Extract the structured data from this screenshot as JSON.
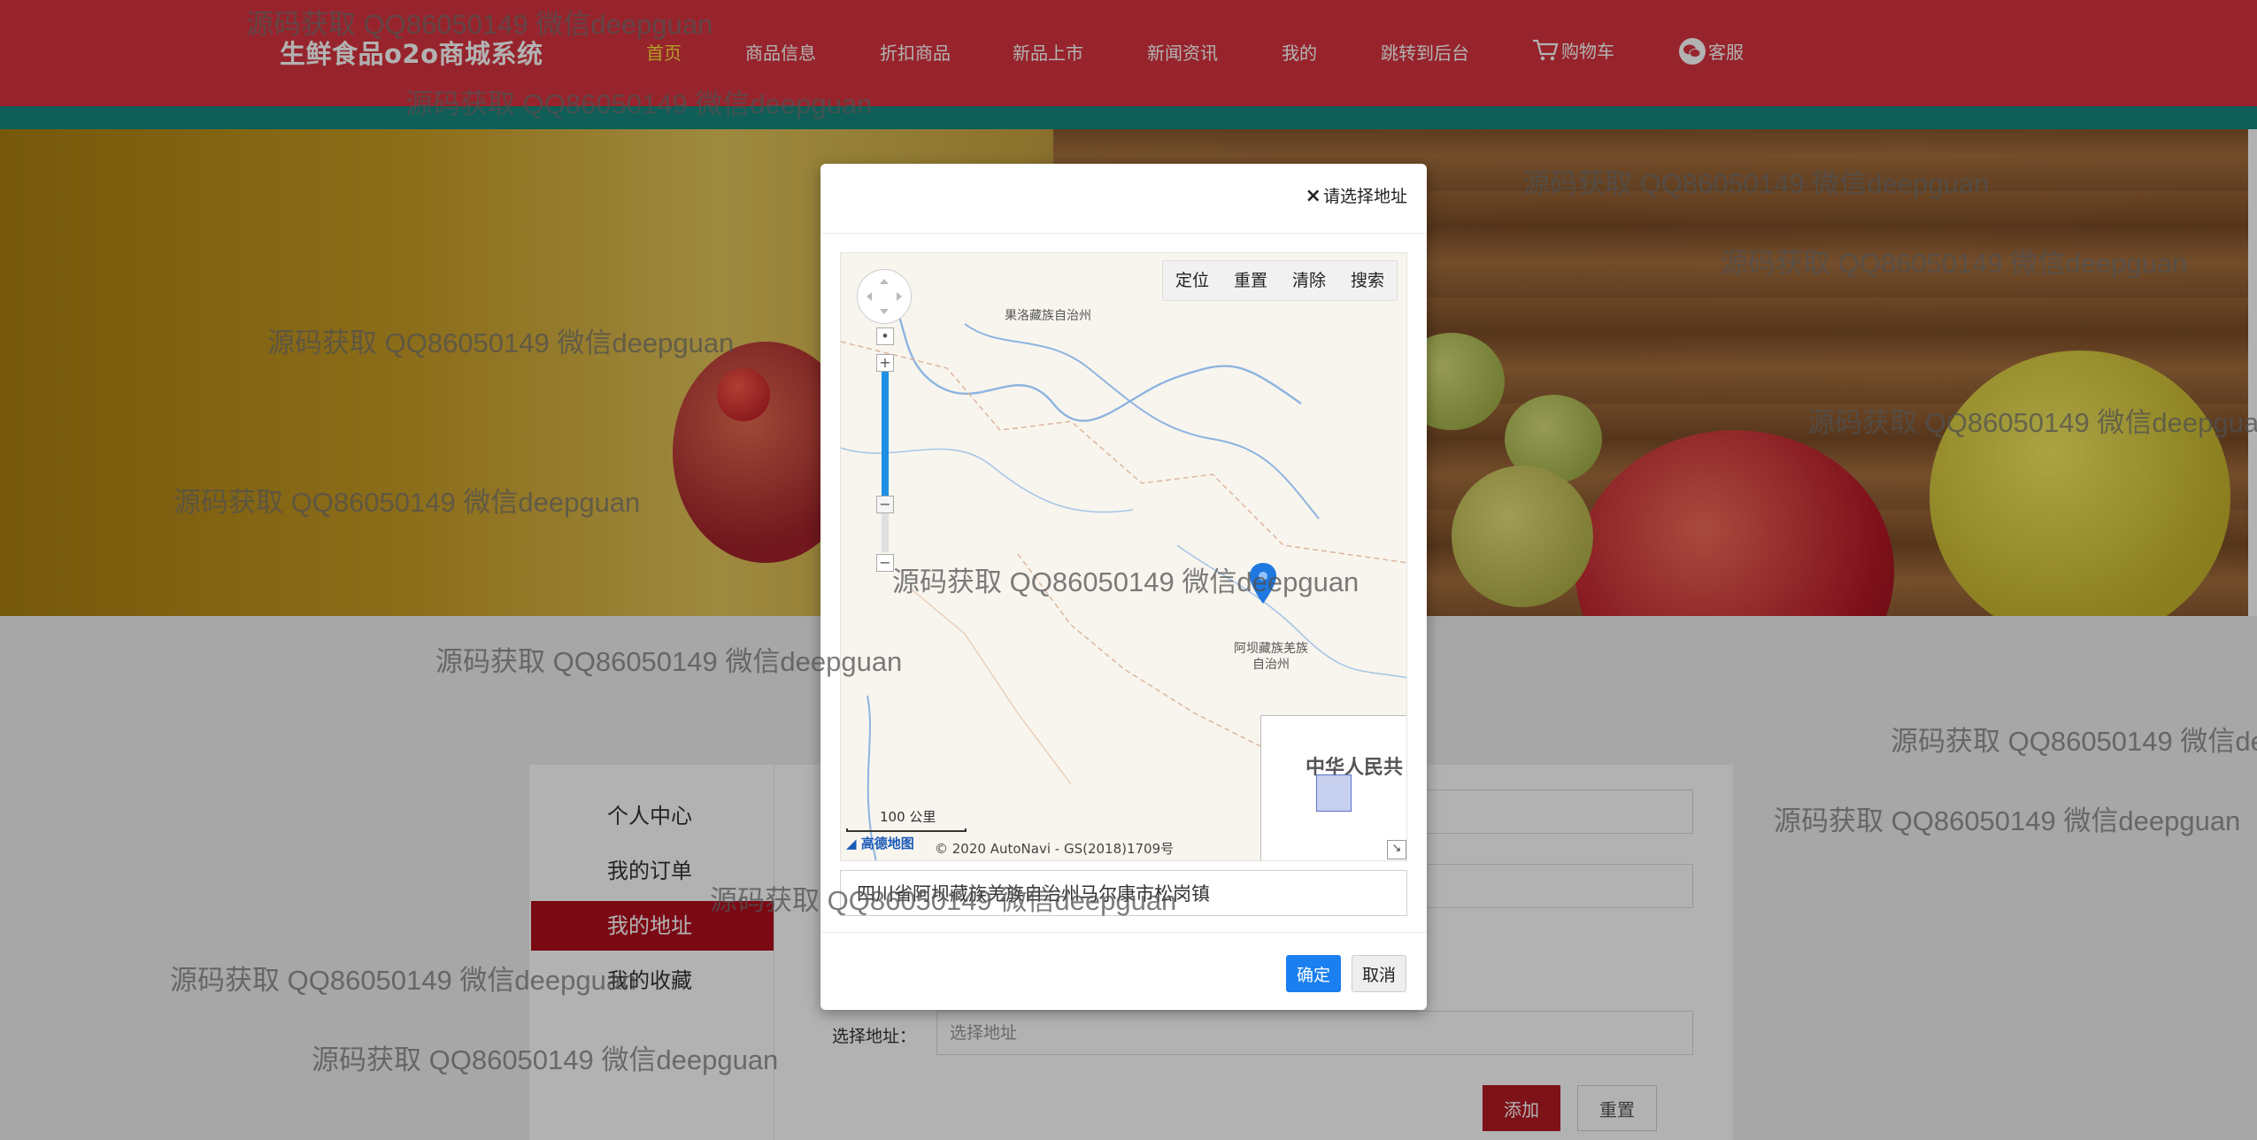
{
  "header": {
    "logo": "生鲜食品o2o商城系统",
    "nav": [
      {
        "label": "首页",
        "active": true
      },
      {
        "label": "商品信息"
      },
      {
        "label": "折扣商品"
      },
      {
        "label": "新品上市"
      },
      {
        "label": "新闻资讯"
      },
      {
        "label": "我的"
      },
      {
        "label": "跳转到后台"
      },
      {
        "label": "购物车",
        "icon": "cart-icon"
      },
      {
        "label": "客服",
        "icon": "wechat-icon"
      }
    ]
  },
  "side_menu": {
    "items": [
      {
        "label": "个人中心"
      },
      {
        "label": "我的订单"
      },
      {
        "label": "我的地址",
        "active": true
      },
      {
        "label": "我的收藏"
      }
    ]
  },
  "form": {
    "select_address_label": "选择地址：",
    "select_address_placeholder": "选择地址",
    "add_label": "添加",
    "reset_label": "重置"
  },
  "modal": {
    "title": "请选择地址",
    "toolbar": [
      "定位",
      "重置",
      "清除",
      "搜索"
    ],
    "map_labels": {
      "golog": "果洛藏族自治州",
      "aba": "阿坝藏族羌族自治州",
      "minimap": "中华人民共"
    },
    "scale": "100 公里",
    "provider": "高德地图",
    "copyright": "© 2020 AutoNavi - GS(2018)1709号",
    "address_value": "四川省阿坝藏族羌族自治州马尔康市松岗镇",
    "ok_label": "确定",
    "cancel_label": "取消"
  },
  "colors": {
    "header_red": "#d8343f",
    "stripe_teal": "#16877d",
    "active_nav": "#ffe13a",
    "menu_active": "#b00e1e",
    "primary_blue": "#1b7ff0"
  },
  "watermark_text": "源码获取 QQ86050149 微信deepguan"
}
